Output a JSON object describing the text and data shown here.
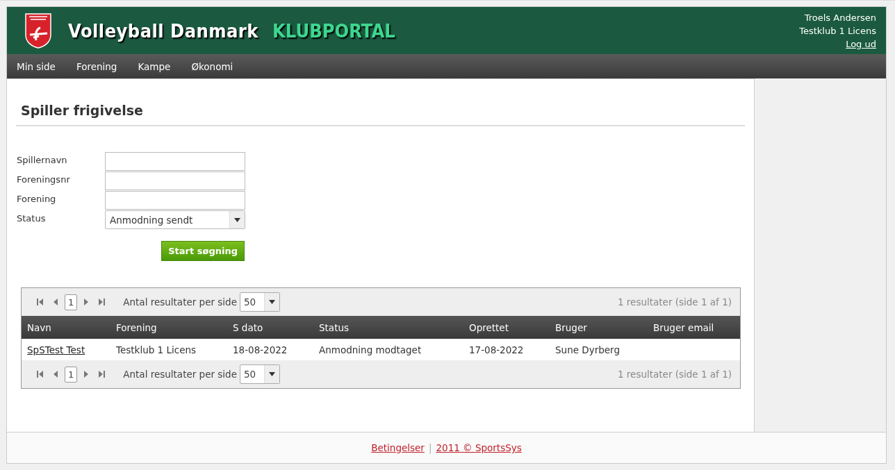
{
  "header": {
    "title": "Volleyball Danmark",
    "subtitle": "KLUBPORTAL",
    "user": "Troels Andersen",
    "club": "Testklub 1 Licens",
    "logout": "Log ud"
  },
  "nav": [
    "Min side",
    "Forening",
    "Kampe",
    "Økonomi"
  ],
  "page_title": "Spiller frigivelse",
  "form": {
    "fields": [
      {
        "kind": "text",
        "label": "Spillernavn"
      },
      {
        "kind": "text",
        "label": "Foreningsnr"
      },
      {
        "kind": "text",
        "label": "Forening"
      },
      {
        "kind": "select",
        "label": "Status",
        "value": "Anmodning sendt"
      }
    ],
    "button": "Start søgning"
  },
  "grid": {
    "pagers": [
      {
        "page": "1",
        "per_page_label": "Antal resultater per side",
        "per_page": "50",
        "summary": "1 resultater (side 1 af 1)"
      },
      {
        "page": "1",
        "per_page_label": "Antal resultater per side",
        "per_page": "50",
        "summary": "1 resultater (side 1 af 1)"
      }
    ],
    "columns": [
      "Navn",
      "Forening",
      "S dato",
      "Status",
      "Oprettet",
      "Bruger",
      "Bruger email"
    ],
    "rows": [
      [
        "SpSTest Test",
        "Testklub 1 Licens",
        "18-08-2022",
        "Anmodning modtaget",
        "17-08-2022",
        "Sune Dyrberg"
      ]
    ]
  },
  "footer": {
    "links": [
      "Betingelser",
      "2011 © SportsSys"
    ],
    "separator": "|"
  }
}
